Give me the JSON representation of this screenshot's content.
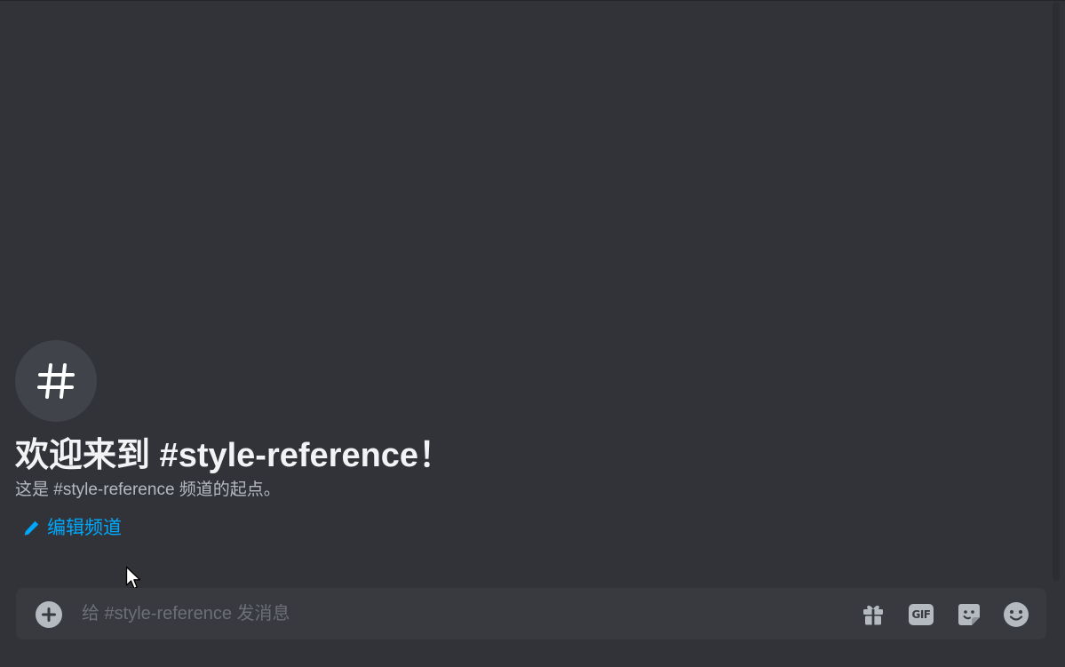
{
  "welcome": {
    "channel_icon": "hash-icon",
    "title": "欢迎来到 #style-reference！",
    "subtitle": "这是 #style-reference 频道的起点。",
    "edit_icon": "pencil-icon",
    "edit_label": "编辑频道"
  },
  "composer": {
    "add_icon": "plus-circle-icon",
    "placeholder": "给 #style-reference 发消息",
    "value": "",
    "gift_icon": "gift-icon",
    "gif_label": "GIF",
    "sticker_icon": "sticker-icon",
    "emoji_icon": "emoji-icon"
  },
  "colors": {
    "background": "#313338",
    "composer": "#383a40",
    "link": "#00a8fc",
    "title": "#f2f3f5",
    "muted": "#b5bac1"
  }
}
